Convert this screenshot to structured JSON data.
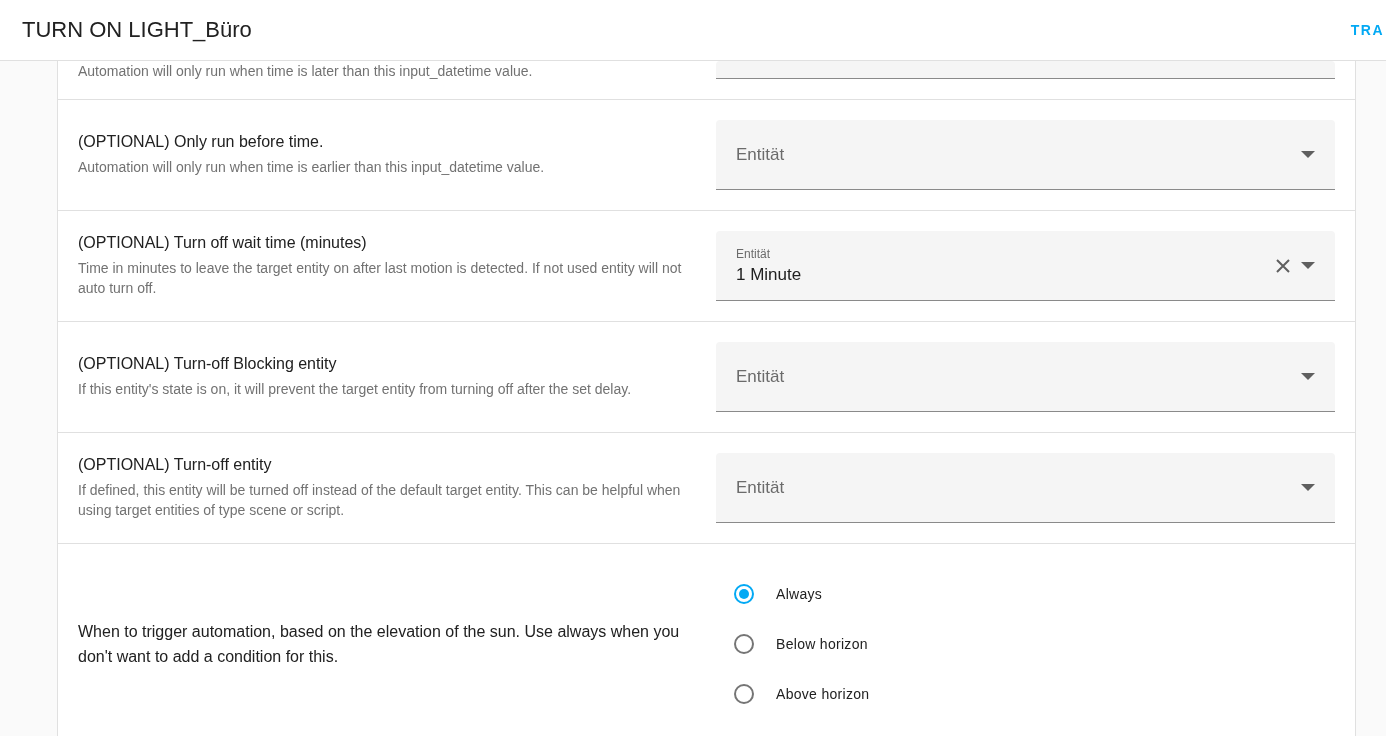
{
  "header": {
    "title": "TURN ON LIGHT_Büro",
    "action": "TRA"
  },
  "partial_row": {
    "description": "Automation will only run when time is later than this input_datetime value."
  },
  "rows": [
    {
      "title": "(OPTIONAL) Only run before time.",
      "description": "Automation will only run when time is earlier than this input_datetime value.",
      "field": {
        "placeholder": "Entität"
      }
    },
    {
      "title": "(OPTIONAL) Turn off wait time (minutes)",
      "description": "Time in minutes to leave the target entity on after last motion is detected. If not used entity will not auto turn off.",
      "field": {
        "label": "Entität",
        "value": "1 Minute",
        "clearable": true
      }
    },
    {
      "title": "(OPTIONAL) Turn-off Blocking entity",
      "description": "If this entity's state is on, it will prevent the target entity from turning off after the set delay.",
      "field": {
        "placeholder": "Entität"
      }
    },
    {
      "title": "(OPTIONAL) Turn-off entity",
      "description": "If defined, this entity will be turned off instead of the default target entity. This can be helpful when using target entities of type scene or script.",
      "field": {
        "placeholder": "Entität"
      }
    }
  ],
  "sun_row": {
    "description": "When to trigger automation, based on the elevation of the sun. Use always when you don't want to add a condition for this.",
    "options": [
      {
        "label": "Always",
        "selected": true
      },
      {
        "label": "Below horizon",
        "selected": false
      },
      {
        "label": "Above horizon",
        "selected": false
      }
    ]
  }
}
